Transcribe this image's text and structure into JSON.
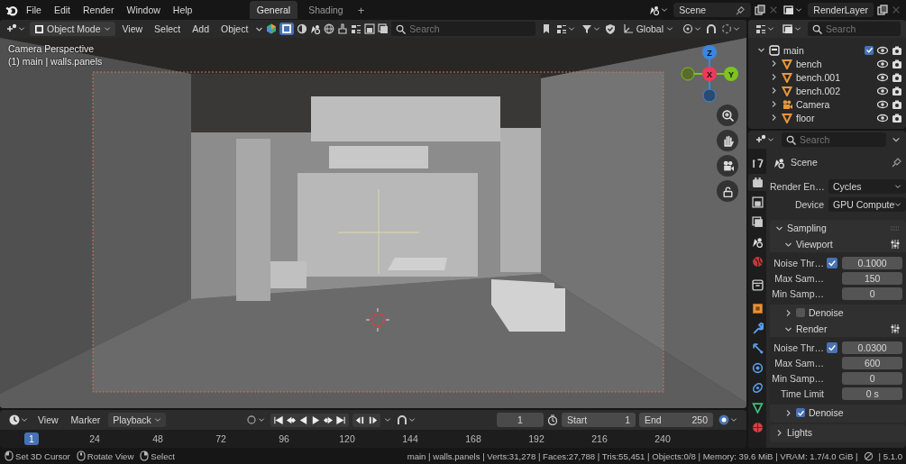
{
  "menu_bar": {
    "menus": [
      "File",
      "Edit",
      "Render",
      "Window",
      "Help"
    ],
    "workspaces": [
      {
        "label": "General",
        "selected": true
      },
      {
        "label": "Shading",
        "selected": false
      }
    ],
    "add_workspace": "+",
    "scene": "Scene",
    "view_layer": "RenderLayer"
  },
  "viewport": {
    "mode": "Object Mode",
    "menus": [
      "View",
      "Select",
      "Add",
      "Object"
    ],
    "search_placeholder": "Search",
    "orientation": "Global",
    "overlay_text": [
      "Camera Perspective",
      "(1) main | walls.panels"
    ],
    "axes": [
      {
        "label": "Z",
        "color": "#3b86e0"
      },
      {
        "label": "X",
        "color": "#f0385a"
      },
      {
        "label": "Y",
        "color": "#7cc41e"
      }
    ]
  },
  "outliner": {
    "search_placeholder": "Search",
    "tree": [
      {
        "name": "main",
        "kind": "collection",
        "expanded": true,
        "checked": true,
        "children": [
          {
            "name": "bench",
            "kind": "mesh",
            "expanded": false
          },
          {
            "name": "bench.001",
            "kind": "mesh",
            "expanded": false
          },
          {
            "name": "bench.002",
            "kind": "mesh",
            "expanded": false
          },
          {
            "name": "Camera",
            "kind": "camera",
            "expanded": false
          },
          {
            "name": "floor",
            "kind": "mesh",
            "expanded": false
          }
        ]
      }
    ]
  },
  "properties": {
    "search_placeholder": "Search",
    "tabs": [
      {
        "kind": "tool",
        "selected": false
      },
      {
        "kind": "render",
        "selected": true
      },
      {
        "kind": "output",
        "selected": false
      },
      {
        "kind": "view_layer",
        "selected": false
      },
      {
        "kind": "scene",
        "selected": false
      },
      {
        "kind": "world",
        "selected": false
      },
      {
        "kind": "collection",
        "selected": false
      },
      {
        "kind": "object",
        "selected": false
      },
      {
        "kind": "modifiers",
        "selected": false
      },
      {
        "kind": "particles",
        "selected": false
      },
      {
        "kind": "physics",
        "selected": false
      },
      {
        "kind": "constraints",
        "selected": false
      },
      {
        "kind": "data",
        "selected": false
      },
      {
        "kind": "material",
        "selected": false
      }
    ],
    "context": "Scene",
    "fields": [
      {
        "label": "Render En…",
        "value": "Cycles"
      },
      {
        "label": "Device",
        "value": "GPU Compute"
      }
    ],
    "panels": [
      {
        "title": "Sampling",
        "expanded": true,
        "sections": [
          {
            "title": "Viewport",
            "expanded": true,
            "rows": [
              {
                "kind": "check_value",
                "label": "Noise Thr…",
                "checked": true,
                "value": "0.1000"
              },
              {
                "kind": "value",
                "label": "Max Sam…",
                "value": "150"
              },
              {
                "kind": "value",
                "label": "Min Samp…",
                "value": "0"
              }
            ],
            "subpanel": {
              "title": "Denoise",
              "expanded": false,
              "checked": false
            }
          },
          {
            "title": "Render",
            "expanded": true,
            "rows": [
              {
                "kind": "check_value",
                "label": "Noise Thr…",
                "checked": true,
                "value": "0.0300"
              },
              {
                "kind": "value",
                "label": "Max Sam…",
                "value": "600"
              },
              {
                "kind": "value",
                "label": "Min Samp…",
                "value": "0"
              },
              {
                "kind": "value",
                "label": "Time Limit",
                "value": "0 s"
              }
            ],
            "subpanel": {
              "title": "Denoise",
              "expanded": false,
              "checked": true
            }
          }
        ]
      },
      {
        "title": "Lights",
        "expanded": false
      }
    ]
  },
  "timeline": {
    "menus": [
      "View",
      "Marker"
    ],
    "playback": "Playback",
    "current_frame": "1",
    "start_label": "Start",
    "start": "1",
    "end_label": "End",
    "end": "250",
    "ruler": [
      {
        "label": "1",
        "selected": true
      },
      {
        "label": "24",
        "selected": false
      },
      {
        "label": "48",
        "selected": false
      },
      {
        "label": "72",
        "selected": false
      },
      {
        "label": "96",
        "selected": false
      },
      {
        "label": "120",
        "selected": false
      },
      {
        "label": "144",
        "selected": false
      },
      {
        "label": "168",
        "selected": false
      },
      {
        "label": "192",
        "selected": false
      },
      {
        "label": "216",
        "selected": false
      },
      {
        "label": "240",
        "selected": false
      }
    ]
  },
  "status_bar": {
    "hints": [
      {
        "kind": "left_click",
        "label": "Set 3D Cursor"
      },
      {
        "kind": "middle_click",
        "label": "Rotate View"
      },
      {
        "kind": "right_click",
        "label": "Select"
      }
    ],
    "stats": "main | walls.panels | Verts:31,278 | Faces:27,788 | Tris:55,451 | Objects:0/8 | Memory: 39.6 MiB | VRAM: 1.7/4.0 GiB |",
    "version": "| 5.1.0"
  }
}
